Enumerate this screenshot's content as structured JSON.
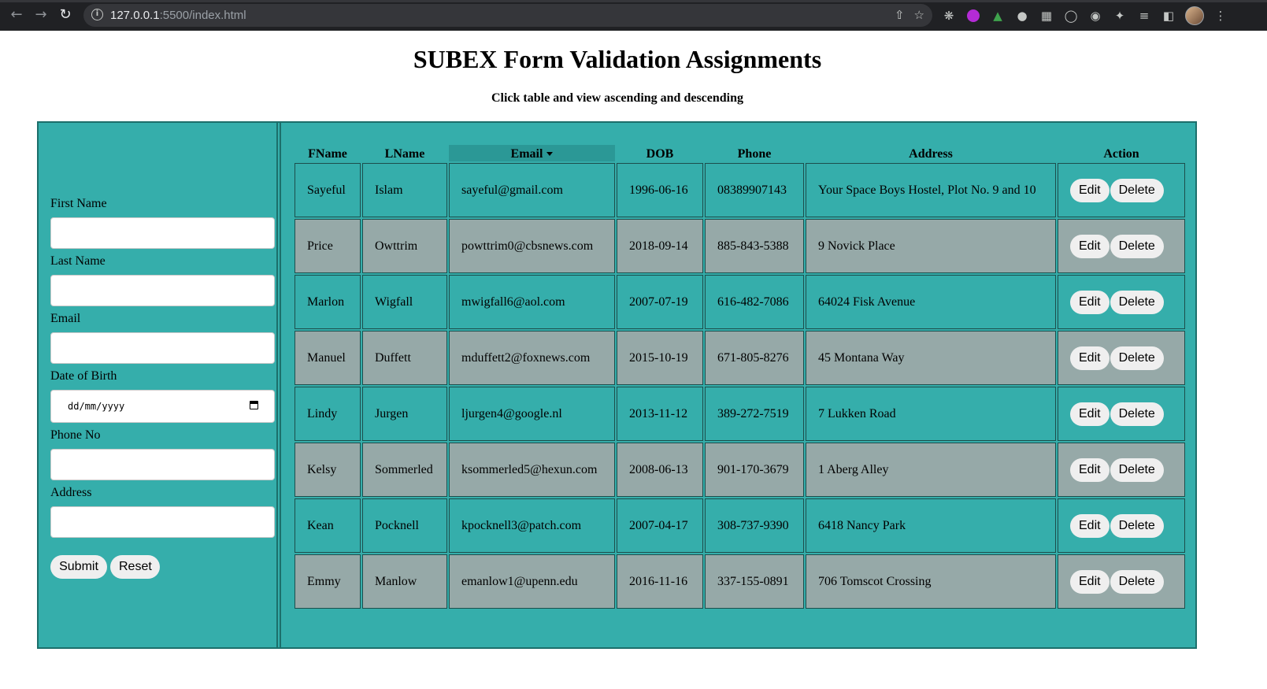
{
  "browser": {
    "url_host": "127.0.0.1",
    "url_rest": ":5500/index.html"
  },
  "page": {
    "title": "SUBEX Form Validation Assignments",
    "subtitle": "Click table and view ascending and descending"
  },
  "form": {
    "first_name_label": "First Name",
    "last_name_label": "Last Name",
    "email_label": "Email",
    "dob_label": "Date of Birth",
    "dob_placeholder": "dd/mm/yyyy",
    "phone_label": "Phone No",
    "address_label": "Address",
    "submit_label": "Submit",
    "reset_label": "Reset"
  },
  "table": {
    "headers": [
      "FName",
      "LName",
      "Email",
      "DOB",
      "Phone",
      "Address",
      "Action"
    ],
    "sorted_column": "Email",
    "edit_label": "Edit",
    "delete_label": "Delete",
    "rows": [
      {
        "fname": "Sayeful",
        "lname": "Islam",
        "email": "sayeful@gmail.com",
        "dob": "1996-06-16",
        "phone": "08389907143",
        "address": "Your Space Boys Hostel, Plot No. 9 and 10"
      },
      {
        "fname": "Price",
        "lname": "Owttrim",
        "email": "powttrim0@cbsnews.com",
        "dob": "2018-09-14",
        "phone": "885-843-5388",
        "address": "9 Novick Place"
      },
      {
        "fname": "Marlon",
        "lname": "Wigfall",
        "email": "mwigfall6@aol.com",
        "dob": "2007-07-19",
        "phone": "616-482-7086",
        "address": "64024 Fisk Avenue"
      },
      {
        "fname": "Manuel",
        "lname": "Duffett",
        "email": "mduffett2@foxnews.com",
        "dob": "2015-10-19",
        "phone": "671-805-8276",
        "address": "45 Montana Way"
      },
      {
        "fname": "Lindy",
        "lname": "Jurgen",
        "email": "ljurgen4@google.nl",
        "dob": "2013-11-12",
        "phone": "389-272-7519",
        "address": "7 Lukken Road"
      },
      {
        "fname": "Kelsy",
        "lname": "Sommerled",
        "email": "ksommerled5@hexun.com",
        "dob": "2008-06-13",
        "phone": "901-170-3679",
        "address": "1 Aberg Alley"
      },
      {
        "fname": "Kean",
        "lname": "Pocknell",
        "email": "kpocknell3@patch.com",
        "dob": "2007-04-17",
        "phone": "308-737-9390",
        "address": "6418 Nancy Park"
      },
      {
        "fname": "Emmy",
        "lname": "Manlow",
        "email": "emanlow1@upenn.edu",
        "dob": "2016-11-16",
        "phone": "337-155-0891",
        "address": "706 Tomscot Crossing"
      }
    ]
  },
  "colors": {
    "panel": "#35aeab",
    "row_alt": "#96a9a8",
    "sorted_header": "#2b9896"
  }
}
